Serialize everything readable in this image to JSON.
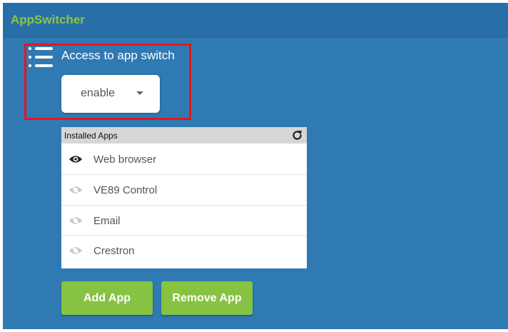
{
  "header": {
    "title": "AppSwitcher"
  },
  "setting": {
    "label": "Access to app switch",
    "icon": "list-icon"
  },
  "dropdown": {
    "selected": "enable",
    "icon": "caret-down-icon"
  },
  "apps": {
    "header_label": "Installed Apps",
    "refresh_icon": "refresh-icon",
    "items": [
      {
        "name": "Web browser",
        "visible": true,
        "icon": "eye-icon"
      },
      {
        "name": "VE89 Control",
        "visible": false,
        "icon": "eye-off-icon"
      },
      {
        "name": "Email",
        "visible": false,
        "icon": "eye-off-icon"
      },
      {
        "name": "Crestron",
        "visible": false,
        "icon": "eye-off-icon"
      }
    ]
  },
  "buttons": {
    "add_label": "Add App",
    "remove_label": "Remove App"
  },
  "colors": {
    "background": "#2f7ab3",
    "title": "#8cc63f",
    "button": "#86c341",
    "highlight": "#e8141c"
  }
}
